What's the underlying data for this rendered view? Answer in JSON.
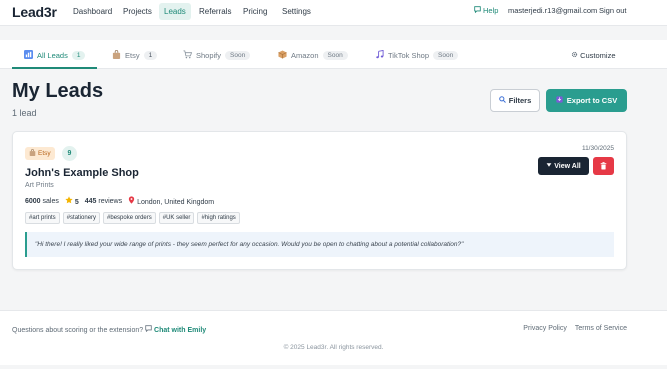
{
  "nav": {
    "brand": "Lead3r",
    "items": [
      {
        "label": "Dashboard",
        "active": false
      },
      {
        "label": "Projects",
        "active": false
      },
      {
        "label": "Leads",
        "active": true
      },
      {
        "label": "Referrals",
        "active": false
      },
      {
        "label": "Pricing",
        "active": false
      },
      {
        "label": "Settings",
        "active": false
      }
    ],
    "help": "Help",
    "email": "masterjedi.r13@gmail.com",
    "signout": "Sign out"
  },
  "tabs": [
    {
      "label": "All Leads",
      "badge": "1",
      "icon": "bar-chart-icon",
      "active": true
    },
    {
      "label": "Etsy",
      "badge": "1",
      "icon": "shopping-bag-icon",
      "active": false
    },
    {
      "label": "Shopify",
      "badge": "Soon",
      "icon": "cart-icon",
      "active": false
    },
    {
      "label": "Amazon",
      "badge": "Soon",
      "icon": "package-icon",
      "active": false
    },
    {
      "label": "TikTok Shop",
      "badge": "Soon",
      "icon": "music-note-icon",
      "active": false
    }
  ],
  "customize": "Customize",
  "header": {
    "title": "My Leads",
    "subtitle": "1 lead",
    "filters_label": "Filters",
    "export_label": "Export to CSV"
  },
  "lead": {
    "platform": "Etsy",
    "score": "9",
    "date": "11/30/2025",
    "view_all_label": "View All",
    "shop_name": "John's Example Shop",
    "category": "Art Prints",
    "sales": "6000",
    "sales_label": "sales",
    "rating": "5",
    "reviews": "445",
    "reviews_label": "reviews",
    "location": "London, United Kingdom",
    "tags": [
      "#art prints",
      "#stationery",
      "#bespoke orders",
      "#UK seller",
      "#high ratings"
    ],
    "message": "\"Hi there! I really liked your wide range of prints - they seem perfect for any occasion. Would you be open to chatting about a potential collaboration?\""
  },
  "footer": {
    "question": "Questions about scoring or the extension?",
    "chat": "Chat with Emily",
    "privacy": "Privacy Policy",
    "terms": "Terms of Service",
    "copyright": "© 2025 Lead3r. All rights reserved."
  },
  "colors": {
    "accent": "#1f8a78",
    "export_button": "#2a9d8f",
    "dark_button": "#1a2533",
    "delete_button": "#e63946"
  }
}
